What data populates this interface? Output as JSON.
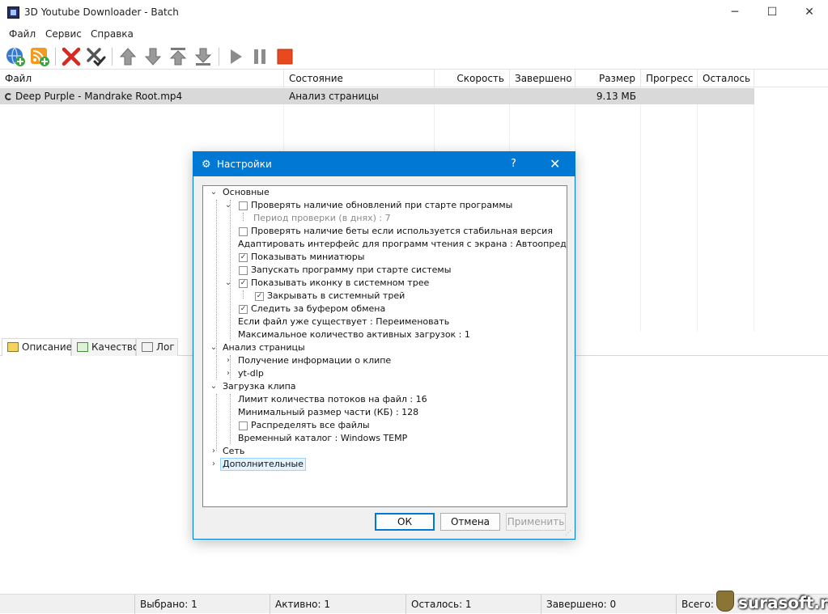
{
  "window": {
    "title": "3D Youtube Downloader - Batch"
  },
  "menu": {
    "items": [
      "Файл",
      "Сервис",
      "Справка"
    ]
  },
  "toolbar": {
    "icons": [
      "add-url-icon",
      "add-rss-icon",
      "delete-icon",
      "clear-completed-icon",
      "move-up-icon",
      "move-down-icon",
      "move-top-icon",
      "move-bottom-icon",
      "start-icon",
      "pause-icon",
      "stop-icon"
    ],
    "colors": {
      "blue": "#3a78c9",
      "green": "#3aa53a",
      "red": "#d62a20",
      "gray": "#8c8c8c",
      "stop": "#e8491e"
    }
  },
  "table": {
    "columns": [
      "Файл",
      "Состояние",
      "Скорость",
      "Завершено",
      "Размер",
      "Прогресс",
      "Осталось"
    ],
    "rows": [
      {
        "file": "Deep Purple - Mandrake Root.mp4",
        "status": "Анализ страницы",
        "speed": "",
        "completed": "",
        "size": "9.13 МБ",
        "progress": "",
        "remaining": ""
      }
    ]
  },
  "tabs": [
    {
      "label": "Описание",
      "icon": "description-icon"
    },
    {
      "label": "Качество",
      "icon": "quality-icon"
    },
    {
      "label": "Лог",
      "icon": "log-icon"
    }
  ],
  "status": {
    "selected": "Выбрано: 1",
    "active": "Активно: 1",
    "remaining": "Осталось: 1",
    "completed": "Завершено: 0",
    "total": "Всего: 1"
  },
  "watermark": {
    "text": "surasoft.ru"
  },
  "dialog": {
    "title": "Настройки",
    "help": "?",
    "close": "✕",
    "tree": {
      "basic": "Основные",
      "check_updates": "Проверять наличие обновлений при старте программы",
      "check_period": "Период проверки (в днях) : 7",
      "check_beta": "Проверять наличие беты если используется стабильная версия",
      "screen_reader": "Адаптировать интерфейс для программ чтения с экрана : Автоопределение",
      "thumbnails": "Показывать миниатюры",
      "autostart": "Запускать программу при старте системы",
      "tray_icon": "Показывать иконку в системном трее",
      "close_to_tray": "Закрывать в системный трей",
      "clipboard": "Следить за буфером обмена",
      "file_exists": "Если файл уже существует : Переименовать",
      "max_downloads": "Максимальное количество активных загрузок : 1",
      "page_analysis": "Анализ страницы",
      "clip_info": "Получение информации о клипе",
      "ytdlp": "yt-dlp",
      "clip_download": "Загрузка клипа",
      "threads_limit": "Лимит количества потоков на файл : 16",
      "min_chunk": "Минимальный размер части (КБ) : 128",
      "distribute": "Распределять все файлы",
      "temp_dir": "Временный каталог : Windows TEMP",
      "network": "Сеть",
      "advanced": "Дополнительные"
    },
    "checks": {
      "check_updates": false,
      "check_beta": false,
      "thumbnails": true,
      "autostart": false,
      "tray_icon": true,
      "close_to_tray": true,
      "clipboard": true,
      "distribute": false
    },
    "buttons": {
      "ok": "ОК",
      "cancel": "Отмена",
      "apply": "Применить"
    }
  }
}
